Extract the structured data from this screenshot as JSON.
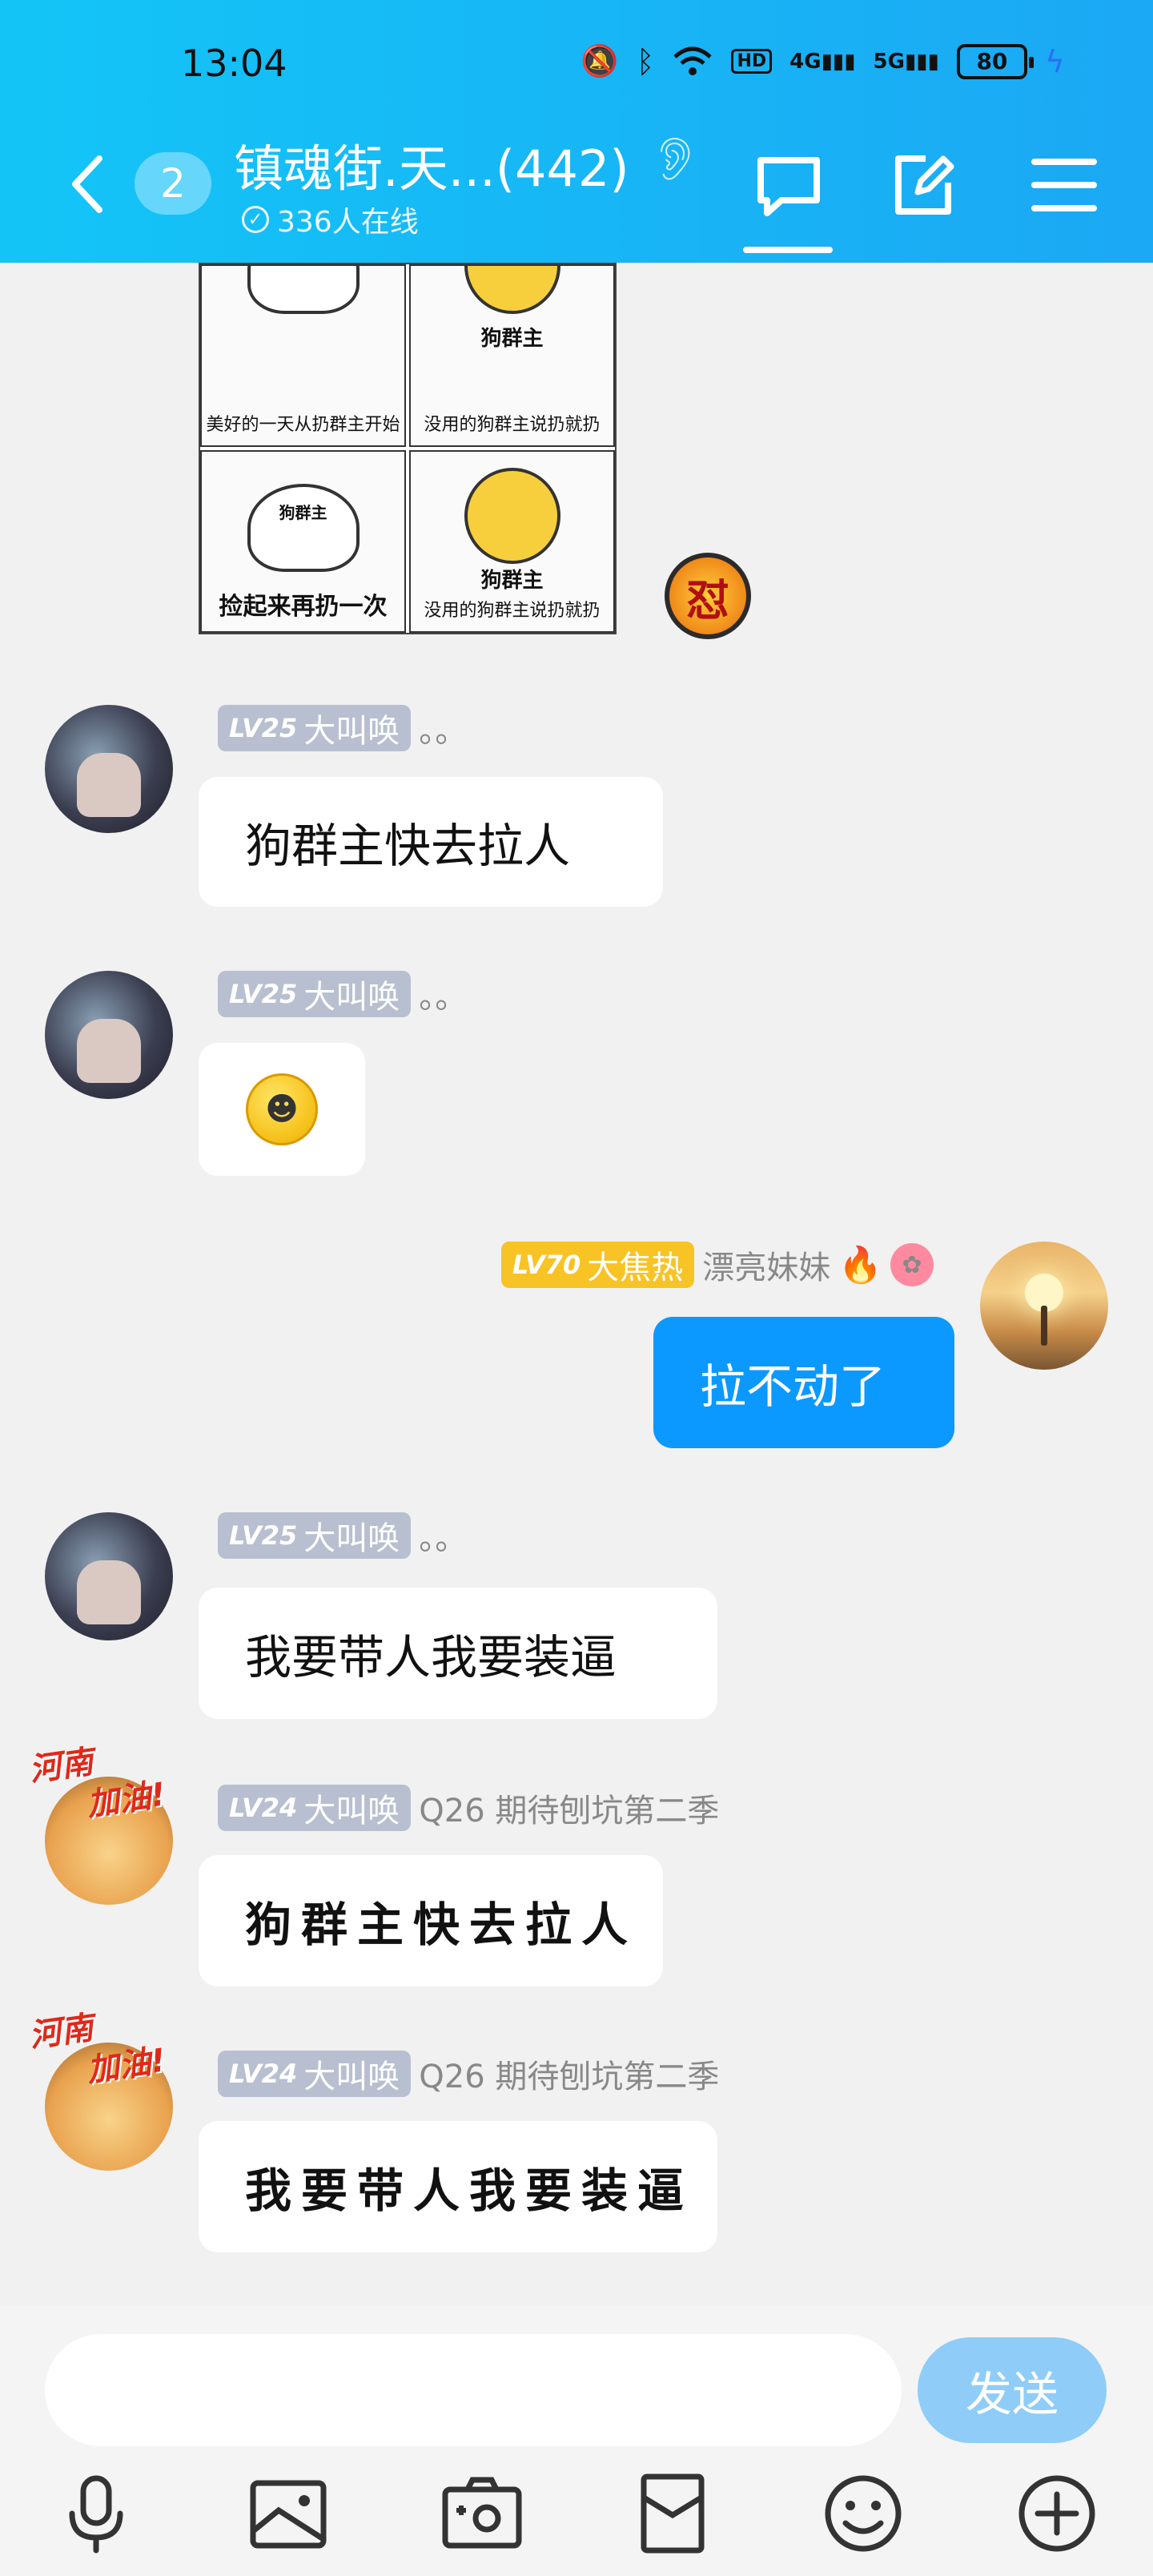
{
  "status_bar": {
    "time": "13:04",
    "battery": "80",
    "hd_label": "HD",
    "net_4g": "4G",
    "net_5g": "5G"
  },
  "header": {
    "unread_badge": "2",
    "title": "镇魂街.天...(442)",
    "online_count": "336人在线"
  },
  "meme": {
    "cells": [
      {
        "caption": "美好的一天从扔群主开始",
        "tag": ""
      },
      {
        "caption": "没用的狗群主说扔就扔",
        "tag": "狗群主"
      },
      {
        "caption": "捡起来再扔一次",
        "tag": "狗群主"
      },
      {
        "caption": "没用的狗群主说扔就扔",
        "tag": "狗群主"
      }
    ],
    "stamp": "怼"
  },
  "messages": [
    {
      "level": "LV25",
      "rank": "大叫唤",
      "nick": "。。",
      "text": "狗群主快去拉人"
    },
    {
      "level": "LV25",
      "rank": "大叫唤",
      "nick": "。。",
      "emoji": "☻"
    },
    {
      "level": "LV70",
      "rank": "大焦热",
      "nick": "漂亮妹妹",
      "text": "拉不动了",
      "self": true
    },
    {
      "level": "LV25",
      "rank": "大叫唤",
      "nick": "。。",
      "text": "我要带人我要装逼"
    },
    {
      "level": "LV24",
      "rank": "大叫唤",
      "nick": "Q26 期待刨坑第二季",
      "text": "狗群主快去拉人",
      "avatar_text_1": "河南",
      "avatar_text_2": "加油!"
    },
    {
      "level": "LV24",
      "rank": "大叫唤",
      "nick": "Q26 期待刨坑第二季",
      "text": "我要带人我要装逼",
      "avatar_text_1": "河南",
      "avatar_text_2": "加油!"
    }
  ],
  "input": {
    "placeholder": "",
    "send_label": "发送"
  },
  "toolbar": [
    "mic-icon",
    "image-icon",
    "camera-icon",
    "red-packet-icon",
    "emoji-icon",
    "plus-icon"
  ],
  "colors": {
    "header_start": "#13c5f7",
    "header_end": "#1ba8f4",
    "self_bubble": "#0b99ff",
    "send_button": "#8fcdf8",
    "level_badge": "#b8bfd0",
    "level_badge_gold": "#f8c324"
  }
}
